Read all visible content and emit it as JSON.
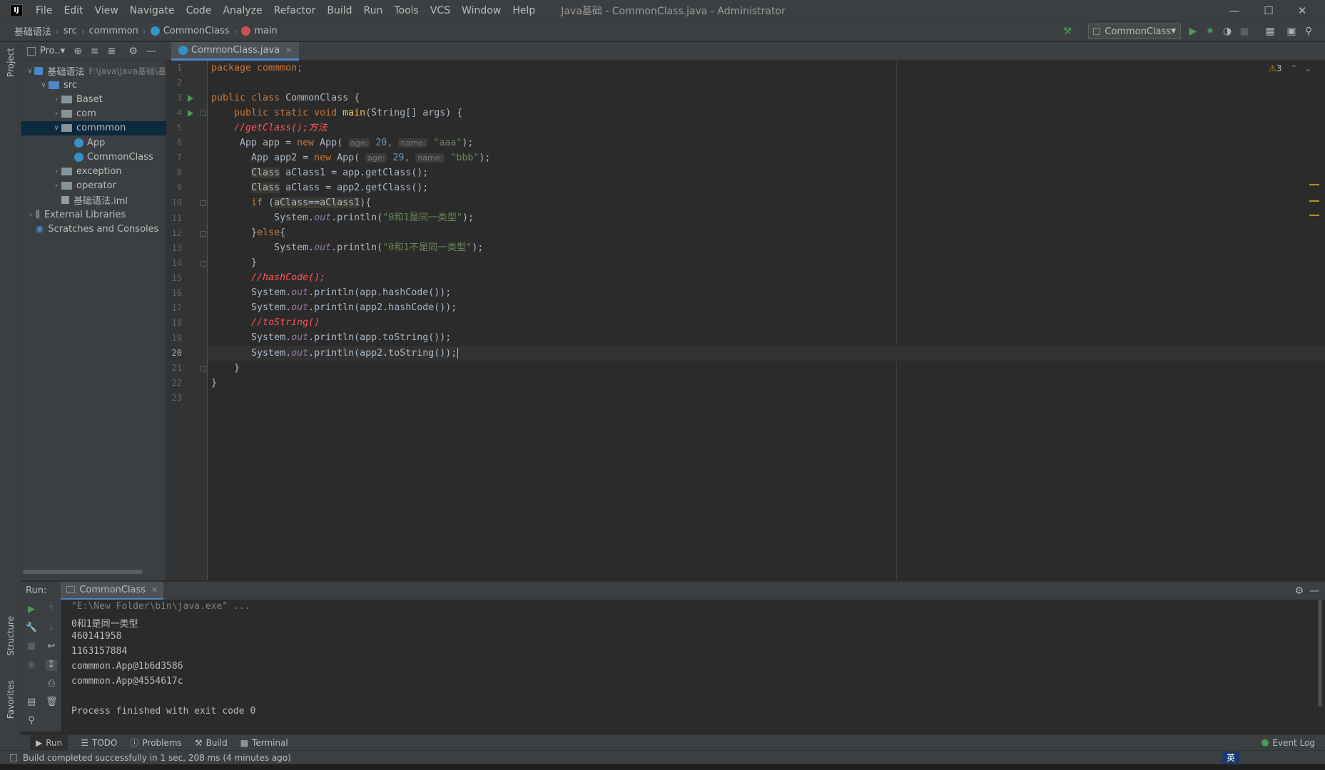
{
  "app": {
    "logo": "IJ",
    "window_title": "Java基础 - CommonClass.java - Administrator",
    "menu": [
      "File",
      "Edit",
      "View",
      "Navigate",
      "Code",
      "Analyze",
      "Refactor",
      "Build",
      "Run",
      "Tools",
      "VCS",
      "Window",
      "Help"
    ]
  },
  "breadcrumb": [
    "基础语法",
    "src",
    "commmon",
    "CommonClass",
    "main"
  ],
  "toolbar": {
    "run_config": "CommonClass"
  },
  "left_strip": {
    "project": "Project",
    "structure": "Structure",
    "favorites": "Favorites"
  },
  "project": {
    "header": "Pro..▾",
    "tree": [
      {
        "label": "基础语法",
        "hint": "F:\\java\\Java基础\\基",
        "depth": 0,
        "expanded": true,
        "type": "module"
      },
      {
        "label": "src",
        "depth": 1,
        "expanded": true,
        "type": "src"
      },
      {
        "label": "Baset",
        "depth": 2,
        "expanded": false,
        "type": "package"
      },
      {
        "label": "com",
        "depth": 2,
        "expanded": false,
        "type": "package"
      },
      {
        "label": "commmon",
        "depth": 2,
        "expanded": true,
        "type": "package",
        "selected": true
      },
      {
        "label": "App",
        "depth": 3,
        "type": "class"
      },
      {
        "label": "CommonClass",
        "depth": 3,
        "type": "class"
      },
      {
        "label": "exception",
        "depth": 2,
        "expanded": false,
        "type": "package"
      },
      {
        "label": "operator",
        "depth": 2,
        "expanded": false,
        "type": "package"
      },
      {
        "label": "基础语法.iml",
        "depth": 2,
        "type": "file"
      },
      {
        "label": "External Libraries",
        "depth": 0,
        "expanded": false,
        "type": "lib"
      },
      {
        "label": "Scratches and Consoles",
        "depth": 0,
        "type": "scratch"
      }
    ]
  },
  "editor": {
    "tab": "CommonClass.java",
    "warnings": "3",
    "line_numbers": [
      "1",
      "2",
      "3",
      "4",
      "5",
      "6",
      "7",
      "8",
      "9",
      "10",
      "11",
      "12",
      "13",
      "14",
      "15",
      "16",
      "17",
      "18",
      "19",
      "20",
      "21",
      "22",
      "23"
    ],
    "current_line": "20",
    "code": {
      "l1": "package commmon;",
      "l3a": "public class ",
      "l3b": "CommonClass {",
      "l4a": "    public static void ",
      "l4b": "main",
      "l4c": "(String[] args) {",
      "l5": "    //getClass();方法",
      "l6a": "     App app = ",
      "l6b": "new ",
      "l6c": "App( ",
      "l6h1": "age:",
      "l6n": " 20",
      "l6d": ", ",
      "l6h2": "name:",
      "l6s": " \"aaa\"",
      "l6e": ");",
      "l7a": "       App app2 = ",
      "l7b": "new ",
      "l7c": "App( ",
      "l7h1": "age:",
      "l7n": " 29",
      "l7d": ", ",
      "l7h2": "name:",
      "l7s": " \"bbb\"",
      "l7e": ");",
      "l8a": "Class",
      "l8b": " aClass1 = app.getClass();",
      "l9a": "Class",
      "l9b": " aClass = app2.getClass();",
      "l10a": "if ",
      "l10b": "(",
      "l10c": "aClass==aClass1",
      "l10d": "){",
      "l11a": "           System.",
      "l11b": "out",
      "l11c": ".println(",
      "l11d": "\"0和1是同一类型\"",
      "l11e": ");",
      "l12a": "       }",
      "l12b": "else",
      "l12c": "{",
      "l13a": "           System.",
      "l13b": "out",
      "l13c": ".println(",
      "l13d": "\"0和1不是同一类型\"",
      "l13e": ");",
      "l14": "       }",
      "l15": "       //hashCode();",
      "l16a": "       System.",
      "l16b": "out",
      "l16c": ".println(app.hashCode());",
      "l17a": "       System.",
      "l17b": "out",
      "l17c": ".println(app2.hashCode());",
      "l18": "       //toString()",
      "l19a": "       System.",
      "l19b": "out",
      "l19c": ".println(app.toString());",
      "l20a": "       System.",
      "l20b": "out",
      "l20c": ".println(app2.toString());",
      "l21": "    }",
      "l22": "}"
    }
  },
  "run": {
    "label": "Run:",
    "tab": "CommonClass",
    "console": [
      "\"E:\\New Folder\\bin\\java.exe\" ...",
      "0和1是同一类型",
      "460141958",
      "1163157884",
      "commmon.App@1b6d3586",
      "commmon.App@4554617c",
      "",
      "Process finished with exit code 0"
    ]
  },
  "bottom_tools": [
    "Run",
    "TODO",
    "Problems",
    "Build",
    "Terminal"
  ],
  "event_log": "Event Log",
  "status": "Build completed successfully in 1 sec, 208 ms (4 minutes ago)",
  "ime": "英"
}
